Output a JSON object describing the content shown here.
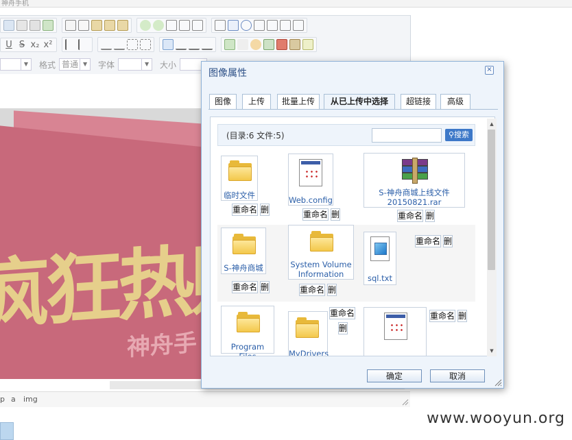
{
  "editor": {
    "top_title": "神舟手机",
    "toolbar_row3": {
      "format_label": "格式",
      "format_value": "普通",
      "font_label": "字体",
      "size_label": "大小"
    },
    "statusbar_path": [
      "p",
      "a",
      "img"
    ],
    "banner_text_big": "疯狂热购",
    "banner_text_small": "神舟手"
  },
  "dialog": {
    "title": "图像属性",
    "tabs": [
      {
        "label": "图像"
      },
      {
        "label": "上传"
      },
      {
        "label": "批量上传"
      },
      {
        "label": "从已上传中选择",
        "active": true
      },
      {
        "label": "超链接"
      },
      {
        "label": "高级"
      }
    ],
    "dir_info": "(目录:6 文件:5)",
    "search_placeholder": "",
    "search_button": "搜索",
    "rename_label": "重命名",
    "delete_label": "删",
    "items": [
      {
        "name": "临时文件",
        "type": "folder"
      },
      {
        "name": "Web.config",
        "type": "doc"
      },
      {
        "name": "S-神舟商城上线文件20150821.rar",
        "type": "rar"
      },
      {
        "name": "S-神舟商城",
        "type": "folder"
      },
      {
        "name": "System Volume Information",
        "type": "folder"
      },
      {
        "name": "sql.txt",
        "type": "txt"
      },
      {
        "name": "Program Files",
        "type": "folder"
      },
      {
        "name": "MyDrivers",
        "type": "folder"
      },
      {
        "name": "",
        "type": "doc"
      }
    ],
    "ok_button": "确定",
    "cancel_button": "取消"
  },
  "watermark": "www.wooyun.org"
}
